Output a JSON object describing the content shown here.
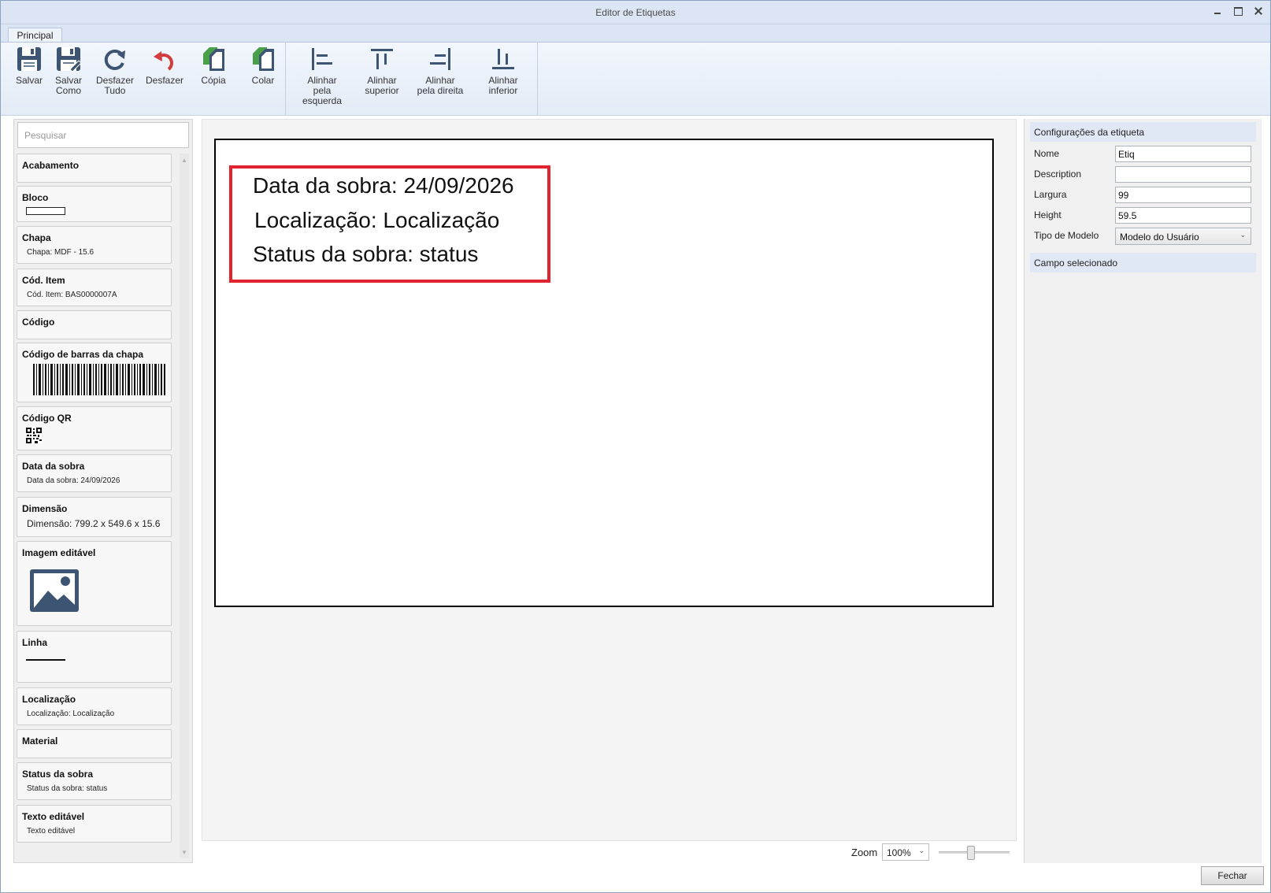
{
  "window": {
    "title": "Editor de Etiquetas"
  },
  "tabs": [
    {
      "label": "Principal"
    }
  ],
  "ribbon": {
    "save": {
      "line1": "Salvar",
      "line2": ""
    },
    "save_as": {
      "line1": "Salvar",
      "line2": "Como"
    },
    "undo_all": {
      "line1": "Desfazer",
      "line2": "Tudo"
    },
    "undo": {
      "line1": "Desfazer",
      "line2": ""
    },
    "copy": {
      "line1": "Cópia",
      "line2": ""
    },
    "paste": {
      "line1": "Colar",
      "line2": ""
    },
    "align_left": {
      "line1": "Alinhar",
      "line2": "pela esquerda"
    },
    "align_top": {
      "line1": "Alinhar",
      "line2": "superior"
    },
    "align_right": {
      "line1": "Alinhar",
      "line2": "pela direita"
    },
    "align_bottom": {
      "line1": "Alinhar",
      "line2": "inferior"
    }
  },
  "search": {
    "placeholder": "Pesquisar"
  },
  "fields": [
    {
      "title": "Acabamento",
      "preview": ""
    },
    {
      "title": "Bloco",
      "preview": ""
    },
    {
      "title": "Chapa",
      "preview": "Chapa: MDF - 15.6"
    },
    {
      "title": "Cód. Item",
      "preview": "Cód. Item: BAS0000007A"
    },
    {
      "title": "Código",
      "preview": ""
    },
    {
      "title": "Código de barras da chapa",
      "preview": ""
    },
    {
      "title": "Código QR",
      "preview": ""
    },
    {
      "title": "Data da sobra",
      "preview": "Data da sobra: 24/09/2026"
    },
    {
      "title": "Dimensão",
      "preview": "Dimensão: 799.2 x 549.6 x 15.6"
    },
    {
      "title": "Imagem editável",
      "preview": ""
    },
    {
      "title": "Linha",
      "preview": ""
    },
    {
      "title": "Localização",
      "preview": "Localização: Localização"
    },
    {
      "title": "Material",
      "preview": ""
    },
    {
      "title": "Status da sobra",
      "preview": "Status da sobra: status"
    },
    {
      "title": "Texto editável",
      "preview": "Texto editável"
    }
  ],
  "label_canvas": {
    "lines": [
      "Data da sobra: 24/09/2026",
      "Localização: Localização",
      "Status da sobra: status"
    ],
    "selection_color": "#e0232e"
  },
  "zoom": {
    "label": "Zoom",
    "value": "100%",
    "slider_level": 0.45
  },
  "properties": {
    "section_title": "Configurações da etiqueta",
    "name": {
      "label": "Nome",
      "value": "Etiq"
    },
    "description": {
      "label": "Description",
      "value": ""
    },
    "width": {
      "label": "Largura",
      "value": "99"
    },
    "height": {
      "label": "Height",
      "value": "59.5"
    },
    "model_type": {
      "label": "Tipo de Modelo",
      "value": "Modelo do Usuário"
    },
    "selected_section_title": "Campo selecionado"
  },
  "footer": {
    "close_label": "Fechar"
  }
}
